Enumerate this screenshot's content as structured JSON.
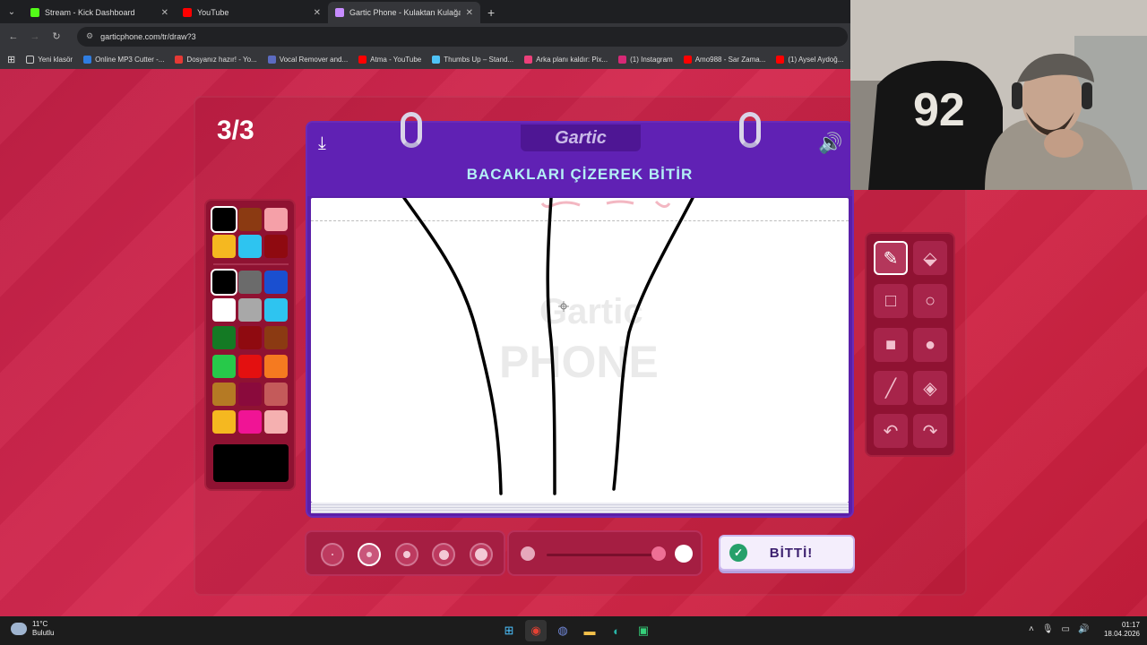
{
  "browser": {
    "tabs": [
      {
        "title": "Stream - Kick Dashboard",
        "icon": "kick-icon",
        "color": "#53fc18",
        "active": false
      },
      {
        "title": "YouTube",
        "icon": "youtube-icon",
        "color": "#ff0000",
        "active": false
      },
      {
        "title": "Gartic Phone - Kulaktan Kulağa",
        "icon": "gartic-icon",
        "color": "#c78cff",
        "active": true
      }
    ],
    "url": "garticphone.com/tr/draw?3",
    "bookmarks": [
      {
        "label": "Yeni klasör",
        "color": "#cccccc"
      },
      {
        "label": "Online MP3 Cutter -...",
        "color": "#2f7de1"
      },
      {
        "label": "Dosyanız hazır! - Yo...",
        "color": "#e53935"
      },
      {
        "label": "Vocal Remover and...",
        "color": "#5c6bc0"
      },
      {
        "label": "Atma - YouTube",
        "color": "#ff0000"
      },
      {
        "label": "Thumbs Up – Stand...",
        "color": "#4fc3f7"
      },
      {
        "label": "Arka planı kaldır: Pix...",
        "color": "#ec407a"
      },
      {
        "label": "(1) Instagram",
        "color": "#d62976"
      },
      {
        "label": "Amo988 - Sar Zama...",
        "color": "#ff0000"
      },
      {
        "label": "(1) Aysel Aydoğ...",
        "color": "#ff0000"
      }
    ]
  },
  "game": {
    "round": "3/3",
    "logo": "Gartic",
    "instruction": "BACAKLARI ÇİZEREK BİTİR",
    "done_label": "BİTTİ!",
    "palette_colors": [
      "#000000",
      "#8b3a12",
      "#f5a0a8",
      "#f5b820",
      "#2ec4f0",
      "#8f0a10",
      "#000000",
      "#6b6b6b",
      "#1a4fd0",
      "#ffffff",
      "#a8a8a8",
      "#2ec4f0",
      "#147a24",
      "#8f0a10",
      "#8b3a12",
      "#27c94a",
      "#e31010",
      "#f57a20",
      "#b57a24",
      "#8a0a3c",
      "#c45a5a",
      "#f5b820",
      "#f01495",
      "#f5b0b0"
    ],
    "selected_color": "#000000",
    "tools": [
      {
        "name": "pencil-tool",
        "glyph": "✎",
        "active": true
      },
      {
        "name": "eraser-tool",
        "glyph": "⌫",
        "active": false
      },
      {
        "name": "rectangle-outline-tool",
        "glyph": "□",
        "active": false
      },
      {
        "name": "ellipse-outline-tool",
        "glyph": "○",
        "active": false
      },
      {
        "name": "rectangle-fill-tool",
        "glyph": "■",
        "active": false
      },
      {
        "name": "ellipse-fill-tool",
        "glyph": "●",
        "active": false
      },
      {
        "name": "line-tool",
        "glyph": "╱",
        "active": false
      },
      {
        "name": "fill-bucket-tool",
        "glyph": "◈",
        "active": false
      },
      {
        "name": "undo-tool",
        "glyph": "↶",
        "active": false
      },
      {
        "name": "redo-tool",
        "glyph": "↷",
        "active": false
      }
    ],
    "brush_sizes_selected_index": 1,
    "opacity_level": 1.0
  },
  "taskbar": {
    "weather_temp": "11°C",
    "weather_desc": "Bulutlu",
    "time": "01:17",
    "date": "18.04.2026"
  }
}
